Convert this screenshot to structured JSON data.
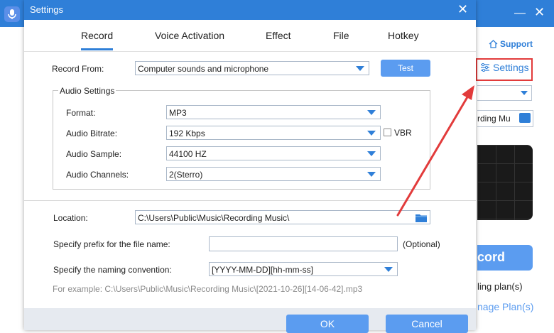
{
  "colors": {
    "accent": "#2f7fd8",
    "button": "#5b9cf0",
    "annotation": "#e23b3b",
    "footer": "#e6eaf0"
  },
  "background_app": {
    "support_label": "Support",
    "settings_link": "Settings",
    "folder_field_value": "rding Mu",
    "record_button": "cord",
    "plan_text": "ling plan(s)",
    "manage_plan_link": "nage Plan(s)"
  },
  "dialog": {
    "title": "Settings",
    "tabs": [
      {
        "label": "Record",
        "active": true
      },
      {
        "label": "Voice Activation",
        "active": false
      },
      {
        "label": "Effect",
        "active": false
      },
      {
        "label": "File",
        "active": false
      },
      {
        "label": "Hotkey",
        "active": false
      }
    ],
    "record_from": {
      "label": "Record  From:",
      "value": "Computer sounds and microphone",
      "test_button": "Test"
    },
    "audio_settings": {
      "group_label": "Audio Settings",
      "format": {
        "label": "Format:",
        "value": "MP3"
      },
      "bitrate": {
        "label": "Audio Bitrate:",
        "value": "192 Kbps"
      },
      "vbr": {
        "label": "VBR",
        "checked": false
      },
      "sample": {
        "label": "Audio Sample:",
        "value": "44100 HZ"
      },
      "channels": {
        "label": "Audio Channels:",
        "value": "2(Sterro)"
      }
    },
    "location": {
      "label": "Location:",
      "value": "C:\\Users\\Public\\Music\\Recording Music\\"
    },
    "prefix": {
      "label": "Specify prefix for the file name:",
      "value": "",
      "optional": "(Optional)"
    },
    "naming": {
      "label": "Specify the naming convention:",
      "value": "[YYYY-MM-DD][hh-mm-ss]"
    },
    "example": "For example: C:\\Users\\Public\\Music\\Recording Music\\[2021-10-26][14-06-42].mp3",
    "ok_button": "OK",
    "cancel_button": "Cancel"
  },
  "icons": {
    "app_logo": "microphone-icon",
    "home": "home-icon",
    "settings": "sliders-icon",
    "folder": "folder-icon",
    "close": "close-icon",
    "minimize": "minimize-icon",
    "dropdown": "chevron-down-icon"
  }
}
